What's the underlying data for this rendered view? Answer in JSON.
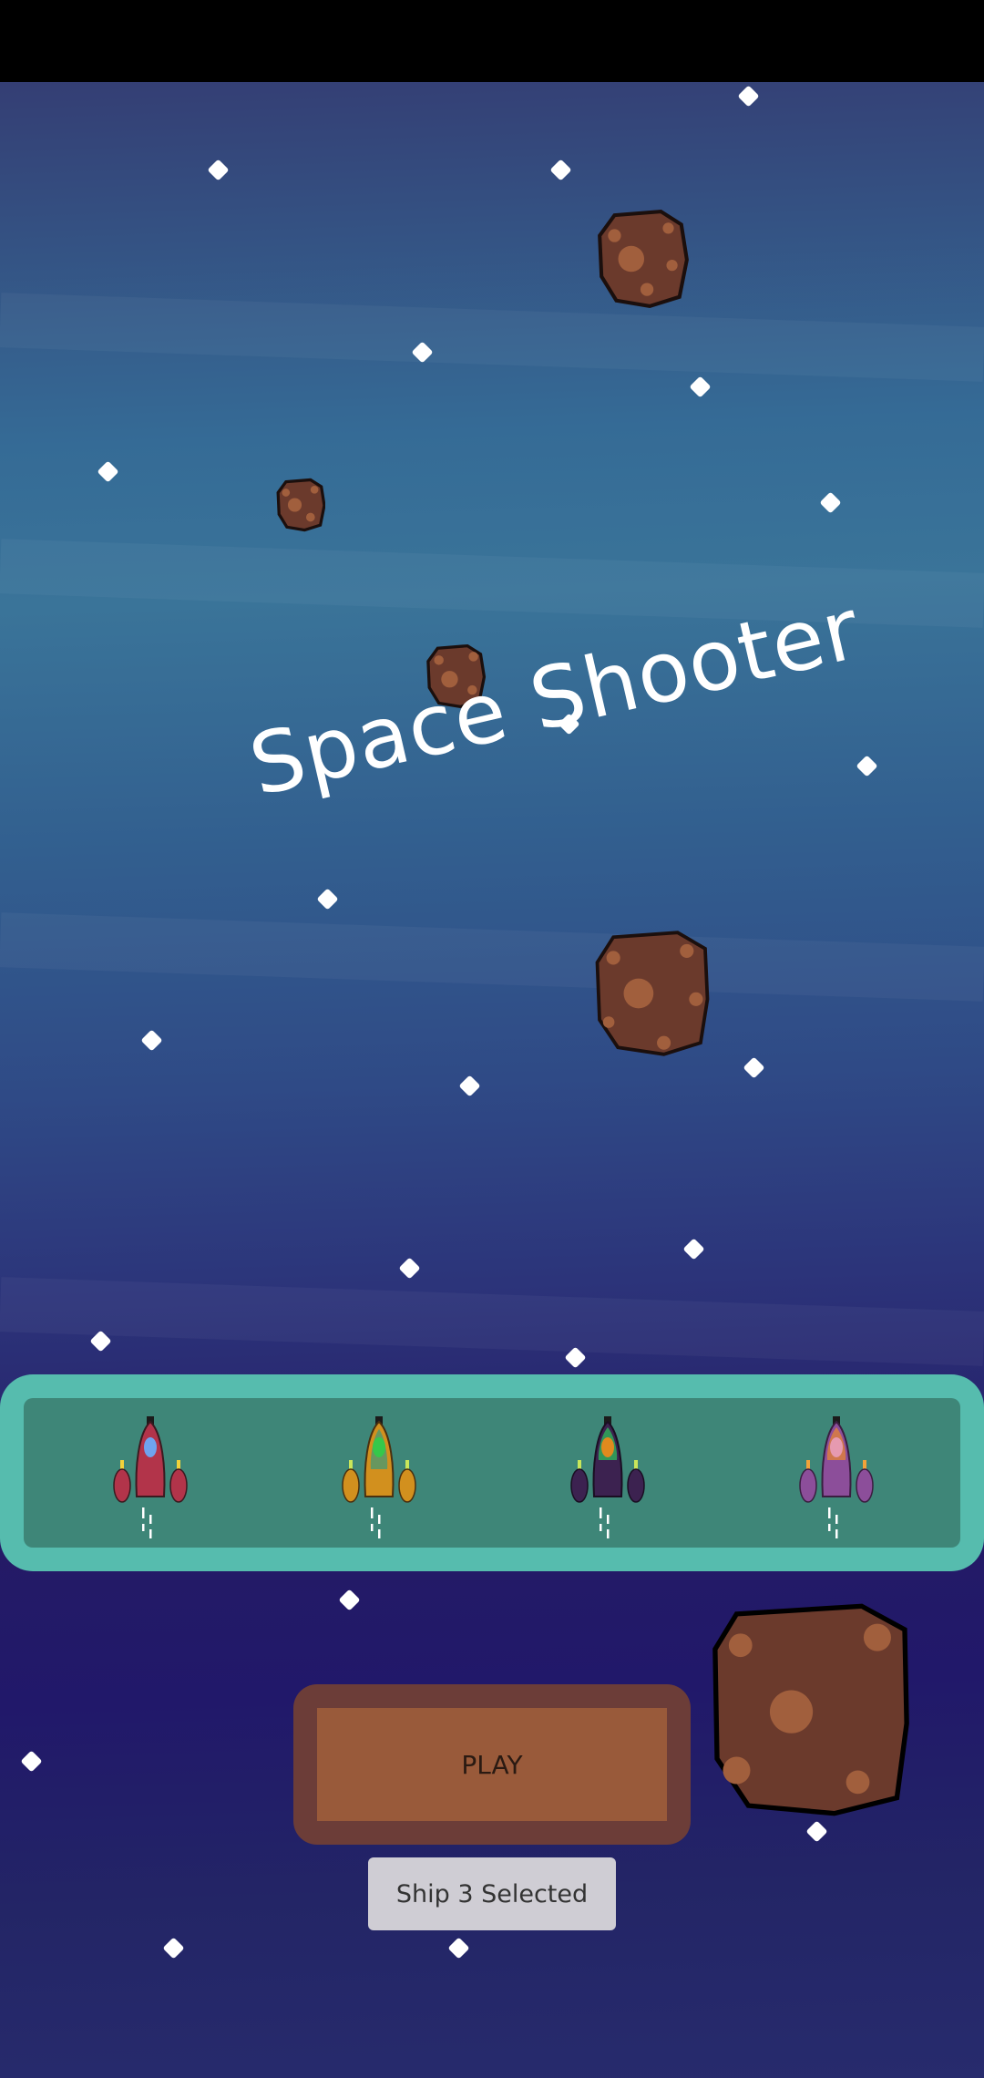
{
  "game": {
    "title": "Space Shooter",
    "play_label": "PLAY",
    "selected_label": "Ship 3 Selected"
  },
  "ships": [
    {
      "name": "ship-1",
      "body_color": "#b2344a",
      "cockpit_color": "#6fa3ee"
    },
    {
      "name": "ship-2",
      "body_color": "#d2901e",
      "cockpit_color": "#35c84a"
    },
    {
      "name": "ship-3",
      "body_color": "#3c2250",
      "cockpit_color": "#e08a1e"
    },
    {
      "name": "ship-4",
      "body_color": "#8c4e9a",
      "cockpit_color": "#e69ab0"
    }
  ],
  "colors": {
    "panel": "#56bcae",
    "panel_inner": "#3e8678",
    "play_outer": "#6c3d38",
    "play_inner": "#995a3a",
    "asteroid": "#6b3a2c",
    "asteroid_crater": "#a15f3d"
  }
}
